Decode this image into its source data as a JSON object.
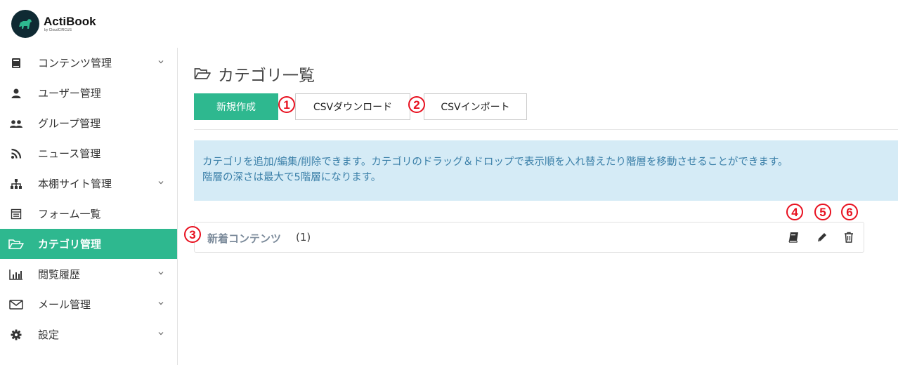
{
  "app": {
    "name": "ActiBook",
    "subtitle": "by CloudCIRCUS"
  },
  "sidebar": {
    "items": [
      {
        "label": "コンテンツ管理",
        "icon": "book-icon",
        "expandable": true
      },
      {
        "label": "ユーザー管理",
        "icon": "user-icon",
        "expandable": false
      },
      {
        "label": "グループ管理",
        "icon": "users-icon",
        "expandable": false
      },
      {
        "label": "ニュース管理",
        "icon": "rss-icon",
        "expandable": false
      },
      {
        "label": "本棚サイト管理",
        "icon": "sitemap-icon",
        "expandable": true
      },
      {
        "label": "フォーム一覧",
        "icon": "form-icon",
        "expandable": false
      },
      {
        "label": "カテゴリ管理",
        "icon": "folder-open-icon",
        "expandable": false,
        "active": true
      },
      {
        "label": "閲覧履歴",
        "icon": "bar-chart-icon",
        "expandable": true
      },
      {
        "label": "メール管理",
        "icon": "envelope-icon",
        "expandable": true
      },
      {
        "label": "設定",
        "icon": "gear-icon",
        "expandable": true
      }
    ]
  },
  "main": {
    "title": "カテゴリ一覧",
    "buttons": {
      "create": "新規作成",
      "csv_download": "CSVダウンロード",
      "csv_import": "CSVインポート"
    },
    "info_lines": [
      "カテゴリを追加/編集/削除できます。カテゴリのドラッグ＆ドロップで表示順を入れ替えたり階層を移動させることができます。",
      "階層の深さは最大で5階層になります。"
    ],
    "categories": [
      {
        "name": "新着コンテンツ",
        "count": "(1)"
      }
    ]
  },
  "markers": [
    "1",
    "2",
    "3",
    "4",
    "5",
    "6"
  ],
  "colors": {
    "accent": "#2eb88f",
    "info_bg": "#d5ebf6",
    "info_text": "#3a7fa8",
    "marker": "#e8101f"
  }
}
